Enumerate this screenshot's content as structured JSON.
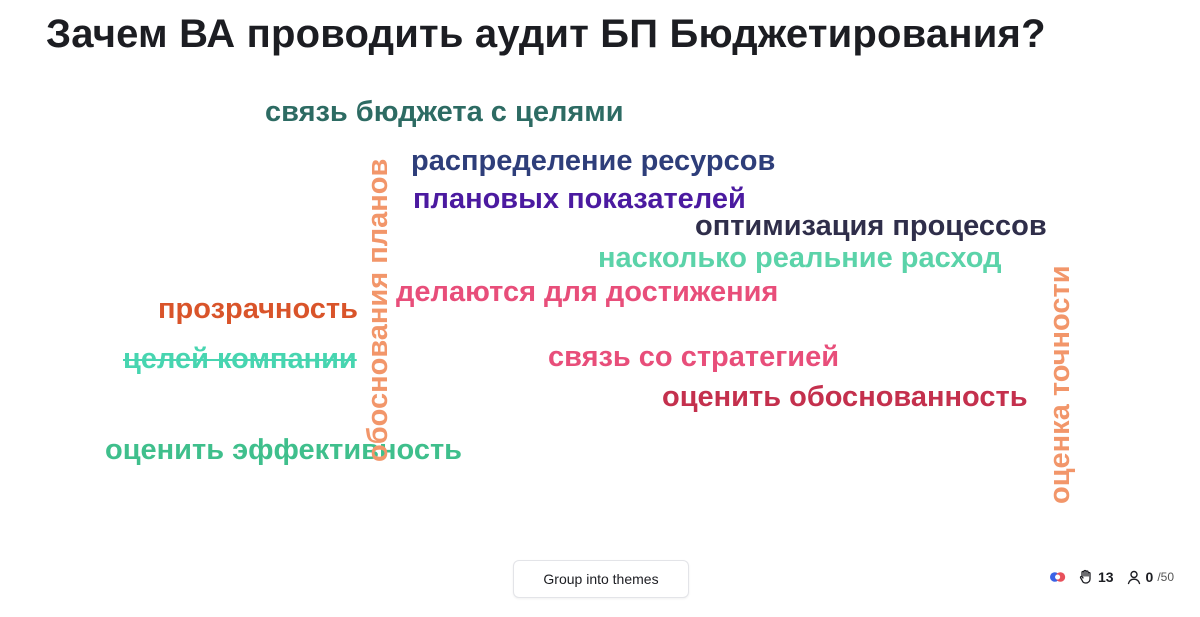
{
  "title": "Зачем ВА проводить аудит БП Бюджетирования?",
  "words": [
    {
      "text": "связь бюджета с целями",
      "color": "#2d6b63"
    },
    {
      "text": "распределение ресурсов",
      "color": "#2e3e7a"
    },
    {
      "text": "плановых показателей",
      "color": "#4b1aa0"
    },
    {
      "text": "оптимизация процессов",
      "color": "#2f2e4a"
    },
    {
      "text": "насколько реальние расход",
      "color": "#5bd3a9"
    },
    {
      "text": "делаются для достижения",
      "color": "#e84e7a"
    },
    {
      "text": "прозрачность",
      "color": "#d9542a"
    },
    {
      "text": "целей компании",
      "color": "#47d5b0"
    },
    {
      "text": "связь со стратегией",
      "color": "#e84e7a"
    },
    {
      "text": "оценить обоснованность",
      "color": "#c4304d"
    },
    {
      "text": "оценить эффективность",
      "color": "#3fbf8c"
    },
    {
      "text": "обоснования планов",
      "color": "#f2966a"
    },
    {
      "text": "оценка точности",
      "color": "#f2966a"
    }
  ],
  "controls": {
    "group_button_label": "Group into themes"
  },
  "stats": {
    "hands_count": "13",
    "participants_count": "0",
    "participants_max": "/50"
  }
}
